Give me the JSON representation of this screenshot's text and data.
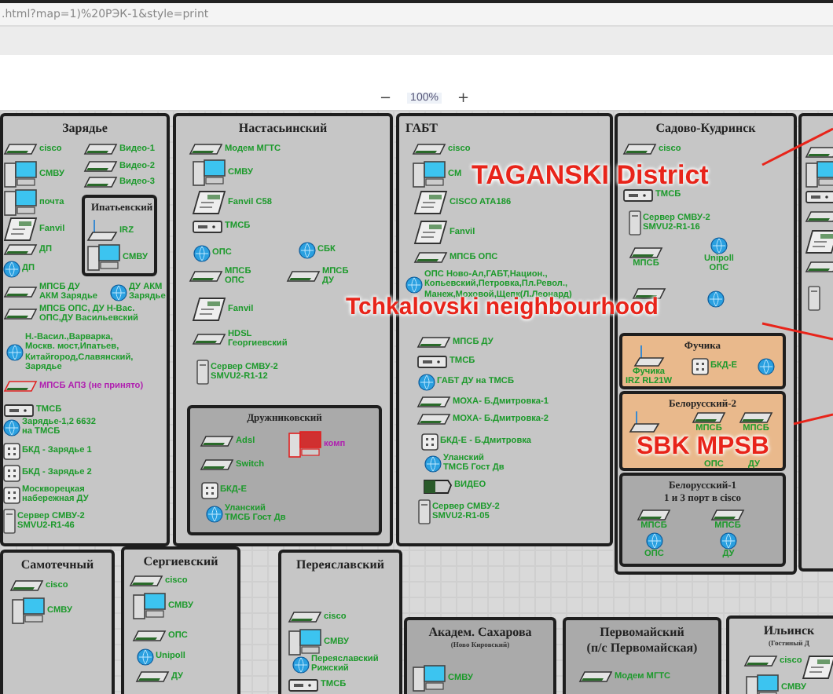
{
  "address_bar": {
    "url": ".html?map=1)%20РЭК-1&style=print"
  },
  "zoom_bar": {
    "zoom_out": "−",
    "level_text": "100%",
    "zoom_in": "+"
  },
  "panels": [
    {
      "title": "Зарядье",
      "kind": "light",
      "items": [
        {
          "kind": "router",
          "label": "cisco"
        },
        {
          "kind": "pc",
          "label": "СМВУ"
        },
        {
          "kind": "pc",
          "label": "почта"
        },
        {
          "kind": "phone",
          "label": "Fanvil"
        },
        {
          "kind": "router",
          "label": "ДП"
        },
        {
          "kind": "globe",
          "label": "ДП"
        },
        {
          "kind": "router",
          "label": "МПСБ ДУ\nАКМ Зарядье"
        },
        {
          "kind": "globe",
          "label": "ДУ АКМ\nЗарядье"
        },
        {
          "kind": "router",
          "label": "МПСБ ОПС, ДУ Н-Вас.\nОПС,ДУ Васильевский"
        },
        {
          "kind": "globe",
          "label": "Н.-Васил.,Варварка,\nМоскв. мост,Ипатьев,\nКитайгород,Славянский,\nЗарядье"
        },
        {
          "kind": "router",
          "label": "МПСБ АПЗ (не принято)",
          "alert": true
        },
        {
          "kind": "modem",
          "label": "ТМСБ"
        },
        {
          "kind": "globe",
          "label": "Зарядье-1,2 6632\nна ТМСБ"
        },
        {
          "kind": "bkd",
          "label": "БКД - Зарядье 1"
        },
        {
          "kind": "bkd",
          "label": "БКД - Зарядье 2"
        },
        {
          "kind": "bkd",
          "label": "Москворецкая\nнабережная ДУ"
        },
        {
          "kind": "server",
          "label": "Сервер СМВУ-2\nSMVU2-R1-46"
        },
        {
          "kind": "router",
          "label": "Видео-1"
        },
        {
          "kind": "router",
          "label": "Видео-2"
        },
        {
          "kind": "router",
          "label": "Видео-3"
        }
      ],
      "subpanels": [
        {
          "title": "Ипатьевский",
          "kind": "light",
          "items": [
            {
              "kind": "wifi",
              "label": "IRZ"
            },
            {
              "kind": "pc",
              "label": "СМВУ"
            }
          ]
        }
      ]
    },
    {
      "title": "Настасьинский",
      "kind": "light",
      "items": [
        {
          "kind": "router",
          "label": "Модем МГТС"
        },
        {
          "kind": "pc",
          "label": "СМВУ"
        },
        {
          "kind": "phone",
          "label": "Fanvil C58"
        },
        {
          "kind": "modem",
          "label": "ТМСБ"
        },
        {
          "kind": "globe",
          "label": "ОПС"
        },
        {
          "kind": "router",
          "label": "МПСБ\nОПС"
        },
        {
          "kind": "globe",
          "label": "СБК"
        },
        {
          "kind": "router",
          "label": "МПСБ\nДУ"
        },
        {
          "kind": "phone",
          "label": "Fanvil"
        },
        {
          "kind": "router",
          "label": "HDSL\nГеоргиевский"
        },
        {
          "kind": "server",
          "label": "Сервер СМВУ-2\nSMVU2-R1-12"
        }
      ],
      "subpanels": [
        {
          "title": "Дружниковский",
          "kind": "dark",
          "items": [
            {
              "kind": "router",
              "label": "Adsl"
            },
            {
              "kind": "router",
              "label": "Switch"
            },
            {
              "kind": "bkd",
              "label": "БКД-Е"
            },
            {
              "kind": "globe",
              "label": "Уланский\nТМСБ Гост Дв"
            },
            {
              "kind": "pc",
              "label": "комп",
              "alert": true
            }
          ]
        }
      ]
    },
    {
      "title": "ГАБТ",
      "kind": "light",
      "items": [
        {
          "kind": "router",
          "label": "cisco"
        },
        {
          "kind": "pc",
          "label": "СМ"
        },
        {
          "kind": "phone",
          "label": "CISCO ATA186"
        },
        {
          "kind": "phone",
          "label": "Fanvil"
        },
        {
          "kind": "router",
          "label": "МПСБ ОПС"
        },
        {
          "kind": "globe",
          "label": "ОПС Ново-Ал,ГАБТ,Национ.,\nКопьевский,Петровка,Пл.Револ.,\nМанеж,Моховой,Щепк(Л.Леонард)"
        },
        {
          "kind": "router",
          "label": "МПСБ ДУ"
        },
        {
          "kind": "modem",
          "label": "ТМСБ"
        },
        {
          "kind": "globe",
          "label": "ГАБТ ДУ на ТМСБ"
        },
        {
          "kind": "router",
          "label": "МОХА- Б.Дмитровка-1"
        },
        {
          "kind": "router",
          "label": "МОХА- Б.Дмитровка-2"
        },
        {
          "kind": "bkd",
          "label": "БКД-Е - Б.Дмитровка"
        },
        {
          "kind": "globe",
          "label": "Уланский\nТМСБ Гост Дв"
        },
        {
          "kind": "camera",
          "label": "ВИДЕО"
        },
        {
          "kind": "server",
          "label": "Сервер СМВУ-2\nSMVU2-R1-05"
        }
      ]
    },
    {
      "title": "Садово-Кудринск",
      "kind": "light",
      "items": [
        {
          "kind": "router",
          "label": "cisco"
        },
        {
          "kind": "modem",
          "label": "ТМСБ"
        },
        {
          "kind": "server",
          "label": "Сервер СМВУ-2\nSMVU2-R1-16"
        },
        {
          "kind": "router",
          "label": "МПСБ"
        },
        {
          "kind": "globe",
          "label": "Unipoll\nОПС"
        },
        {
          "kind": "router"
        },
        {
          "kind": "globe"
        }
      ],
      "subpanels": [
        {
          "title": "Фучика",
          "kind": "orange",
          "items": [
            {
              "kind": "wifi",
              "label": "Фучика\nIRZ RL21W"
            },
            {
              "kind": "bkd",
              "label": "БКД-Е"
            },
            {
              "kind": "globe"
            }
          ]
        },
        {
          "title": "Белорусский-2",
          "kind": "orange",
          "items": [
            {
              "kind": "wifi"
            },
            {
              "kind": "router",
              "label": "МПСБ"
            },
            {
              "kind": "router",
              "label": "МПСБ"
            },
            {
              "kind": "text",
              "label": "ОПС"
            },
            {
              "kind": "text",
              "label": "ДУ"
            }
          ]
        },
        {
          "title": "Белорусский-1\n1 и 3 порт в cisco",
          "kind": "dark",
          "items": [
            {
              "kind": "router",
              "label": "МПСБ"
            },
            {
              "kind": "globe",
              "label": "ОПС"
            },
            {
              "kind": "router",
              "label": "МПСБ"
            },
            {
              "kind": "globe",
              "label": "ДУ"
            }
          ]
        }
      ]
    },
    {
      "kind": "light",
      "items": [
        {
          "kind": "router"
        },
        {
          "kind": "pc"
        },
        {
          "kind": "modem"
        },
        {
          "kind": "router"
        },
        {
          "kind": "phone"
        },
        {
          "kind": "router"
        },
        {
          "kind": "server"
        }
      ]
    },
    {
      "title": "Самотечный",
      "kind": "light",
      "items": [
        {
          "kind": "router",
          "label": "cisco"
        },
        {
          "kind": "pc",
          "label": "СМВУ"
        }
      ]
    },
    {
      "title": "Сергиевский",
      "kind": "light",
      "items": [
        {
          "kind": "router",
          "label": "cisco"
        },
        {
          "kind": "pc",
          "label": "СМВУ"
        },
        {
          "kind": "router",
          "label": "ОПС"
        },
        {
          "kind": "globe",
          "label": "Unipoll"
        },
        {
          "kind": "router",
          "label": "ДУ"
        }
      ]
    },
    {
      "title": "Переяславский",
      "kind": "light",
      "items": [
        {
          "kind": "router",
          "label": "cisco"
        },
        {
          "kind": "pc",
          "label": "СМВУ"
        },
        {
          "kind": "globe",
          "label": "Переяславский\nРижский"
        },
        {
          "kind": "modem",
          "label": "ТМСБ"
        }
      ]
    },
    {
      "title": "Академ. Сахарова",
      "subtitle": "(Ново Кировский)",
      "kind": "dark",
      "items": [
        {
          "kind": "pc",
          "label": "СМВУ"
        }
      ]
    },
    {
      "title": "Первомайский\n(п/с Первомайская)",
      "kind": "dark",
      "items": [
        {
          "kind": "router",
          "label": "Модем МГТС"
        }
      ]
    },
    {
      "title": "Ильинск",
      "subtitle": "(Гостиный Д",
      "kind": "light",
      "items": [
        {
          "kind": "router",
          "label": "cisco"
        },
        {
          "kind": "pc",
          "label": "СМВУ"
        },
        {
          "kind": "phone"
        }
      ]
    }
  ],
  "annotations": [
    {
      "text": "TAGANSKI District"
    },
    {
      "text": "Tchkalovski neighbourhood"
    },
    {
      "text": "SBK MPSB"
    }
  ]
}
